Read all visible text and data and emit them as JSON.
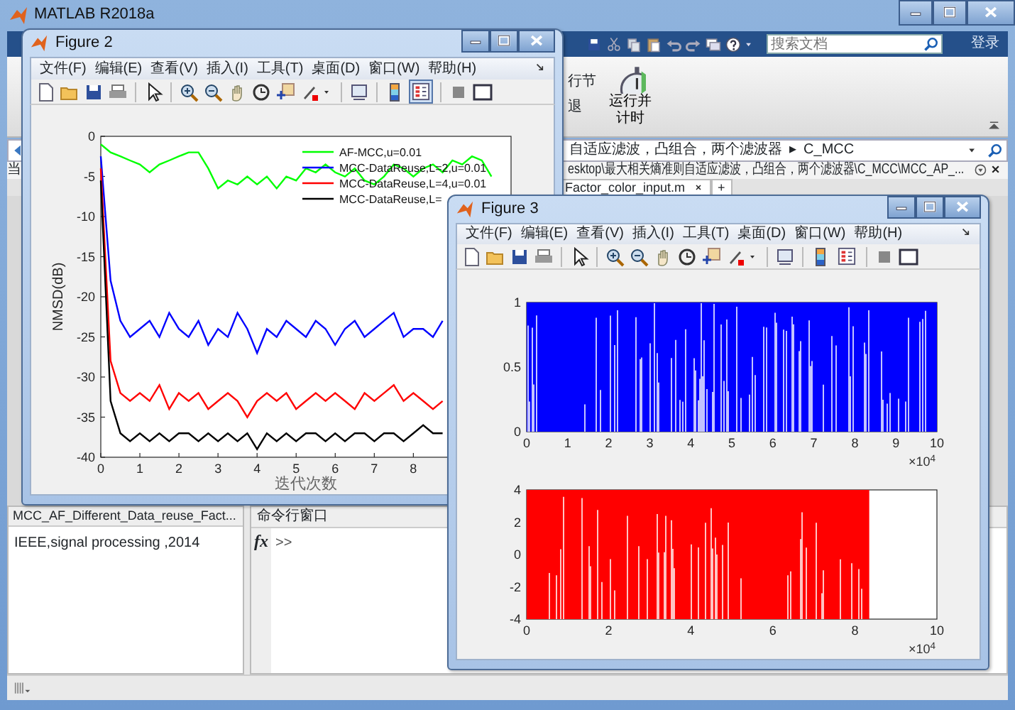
{
  "main_window": {
    "title": "MATLAB R2018a",
    "search": {
      "placeholder": "搜索文档"
    },
    "login": "登录",
    "ribbon": {
      "section_cut": "行节",
      "back_cut": "退",
      "run_and_time": "运行并计时"
    },
    "address": {
      "crumbs": [
        "自适应滤波，凸组合，两个滤波器",
        "C_MCC"
      ],
      "separator": "▸"
    },
    "path": "esktop\\最大相关熵准则自适应滤波，凸组合，两个滤波器\\C_MCC\\MCC_AP_...",
    "side_label": "当",
    "tab": {
      "label": "Factor_color_input.m",
      "new_tab": "+"
    },
    "details": {
      "file": "MCC_AF_Different_Data_reuse_Fact...",
      "text": "IEEE,signal processing ,2014"
    },
    "command_window": {
      "title": "命令行窗口",
      "fx": "fx",
      "prompt": ">>"
    }
  },
  "figures": [
    {
      "title": "Figure 2",
      "menu": [
        "文件(F)",
        "编辑(E)",
        "查看(V)",
        "插入(I)",
        "工具(T)",
        "桌面(D)",
        "窗口(W)",
        "帮助(H)"
      ],
      "legend_pressed": true,
      "chart_data": {
        "type": "line",
        "xlabel": "迭代次数",
        "ylabel": "NMSD(dB)",
        "xlim": [
          0,
          10.5
        ],
        "ylim": [
          -40,
          0
        ],
        "xticks": [
          0,
          1,
          2,
          3,
          4,
          5,
          6,
          7,
          8
        ],
        "yticks": [
          0,
          -5,
          -10,
          -15,
          -20,
          -25,
          -30,
          -35,
          -40
        ],
        "legend": "upper right",
        "x": [
          0,
          0.25,
          0.5,
          0.75,
          1,
          1.25,
          1.5,
          1.75,
          2,
          2.25,
          2.5,
          2.75,
          3,
          3.25,
          3.5,
          3.75,
          4,
          4.25,
          4.5,
          4.75,
          5,
          5.25,
          5.5,
          5.75,
          6,
          6.25,
          6.5,
          6.75,
          7,
          7.25,
          7.5,
          7.75,
          8,
          8.25,
          8.5,
          8.75,
          9,
          9.25,
          9.5,
          9.75,
          10
        ],
        "series": [
          {
            "name": "AF-MCC,u=0.01",
            "color": "#00ff00",
            "values": [
              -1,
              -2,
              -2.5,
              -3,
              -3.5,
              -4.5,
              -3.5,
              -3,
              -2.5,
              -2,
              -2,
              -4,
              -6.5,
              -5.5,
              -6,
              -5,
              -6,
              -5,
              -6.5,
              -5,
              -5.5,
              -4,
              -4.5,
              -3.5,
              -4.5,
              -5,
              -4,
              -5.5,
              -6,
              -5,
              -3.5,
              -4,
              -5,
              -4,
              -3.5,
              -4.5,
              -3,
              -3.5,
              -2.5,
              -3,
              -5
            ]
          },
          {
            "name": "MCC-DataReuse,L=2,u=0.01",
            "color": "#0000ff",
            "values": [
              -2.5,
              -18,
              -23,
              -25,
              -24,
              -23,
              -25,
              -22,
              -24,
              -25,
              -23,
              -26,
              -24,
              -25,
              -22,
              -24,
              -27,
              -24,
              -25,
              -23,
              -24,
              -25,
              -23,
              -24,
              -26,
              -24,
              -23,
              -25,
              -24,
              -23,
              -22,
              -25,
              -24,
              -24,
              -25,
              -23,
              null,
              null,
              null,
              null,
              null
            ]
          },
          {
            "name": "MCC-DataReuse,L=4,u=0.01",
            "color": "#ff0000",
            "values": [
              -4,
              -28,
              -32,
              -33,
              -32,
              -33,
              -31,
              -34,
              -32,
              -33,
              -32,
              -34,
              -33,
              -32,
              -33,
              -35,
              -33,
              -32,
              -33,
              -32,
              -34,
              -33,
              -32,
              -33,
              -32,
              -33,
              -34,
              -32,
              -33,
              -32,
              -31,
              -33,
              -32,
              -33,
              -34,
              -33,
              null,
              null,
              null,
              null,
              null
            ]
          },
          {
            "name": "MCC-DataReuse,L=",
            "color": "#000000",
            "values": [
              -5.5,
              -33,
              -37,
              -38,
              -37,
              -38,
              -37,
              -38,
              -37,
              -37,
              -38,
              -37,
              -38,
              -37,
              -38,
              -37,
              -39,
              -37,
              -38,
              -37,
              -38,
              -37,
              -37,
              -38,
              -37,
              -38,
              -37,
              -37,
              -38,
              -37,
              -37,
              -38,
              -37,
              -36,
              -37,
              -37,
              null,
              null,
              null,
              null,
              null
            ]
          }
        ]
      }
    },
    {
      "title": "Figure 3",
      "menu": [
        "文件(F)",
        "编辑(E)",
        "查看(V)",
        "插入(I)",
        "工具(T)",
        "桌面(D)",
        "窗口(W)",
        "帮助(H)"
      ],
      "legend_pressed": false,
      "plots": [
        {
          "kind": "unit",
          "yticks": [
            "1",
            "0.5",
            "0"
          ],
          "xticks": [
            "0",
            "1",
            "2",
            "3",
            "4",
            "5",
            "6",
            "7",
            "8",
            "9",
            "10"
          ],
          "x_exponent": "×10$^{4}$"
        },
        {
          "kind": "bipolar",
          "yticks": [
            "4",
            "2",
            "0",
            "-2",
            "-4"
          ],
          "xticks": [
            "0",
            "2",
            "4",
            "6",
            "8",
            "10"
          ],
          "x_exponent": "×10$^{4}$"
        }
      ]
    }
  ]
}
